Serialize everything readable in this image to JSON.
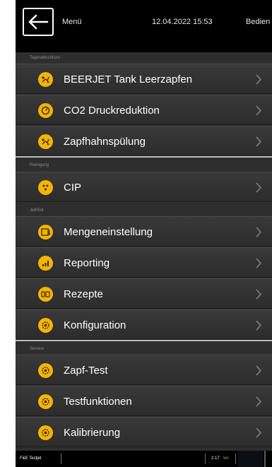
{
  "header": {
    "title": "Menü",
    "datetime": "12.04.2022 15:53",
    "user": "Bedien"
  },
  "sections": [
    {
      "label": "Tagesabschluss",
      "items": [
        {
          "label": "BEERJET Tank Leerzapfen",
          "icon": "tap-icon"
        },
        {
          "label": "CO2 Druckreduktion",
          "icon": "pressure-gauge-icon"
        },
        {
          "label": "Zapfhahnspülung",
          "icon": "tap-rinse-icon"
        }
      ]
    },
    {
      "label": "Reinigung",
      "items": [
        {
          "label": "CIP",
          "icon": "cleaning-icon"
        }
      ]
    },
    {
      "label": "JetPilot",
      "items": [
        {
          "label": "Mengeneinstellung",
          "icon": "quantity-icon"
        },
        {
          "label": "Reporting",
          "icon": "chart-icon"
        },
        {
          "label": "Rezepte",
          "icon": "recipe-icon"
        },
        {
          "label": "Konfiguration",
          "icon": "gear-icon"
        }
      ]
    },
    {
      "label": "Service",
      "items": [
        {
          "label": "Zapf-Test",
          "icon": "gear-icon"
        },
        {
          "label": "Testfunktionen",
          "icon": "gear-icon"
        },
        {
          "label": "Kalibrierung",
          "icon": "gear-icon"
        }
      ]
    }
  ],
  "statusbar": {
    "left": "F&E Testjet",
    "value": "2.17",
    "unit": "wn"
  },
  "colors": {
    "accent": "#f5b400",
    "background": "#2e2e2e",
    "header": "#000000"
  }
}
